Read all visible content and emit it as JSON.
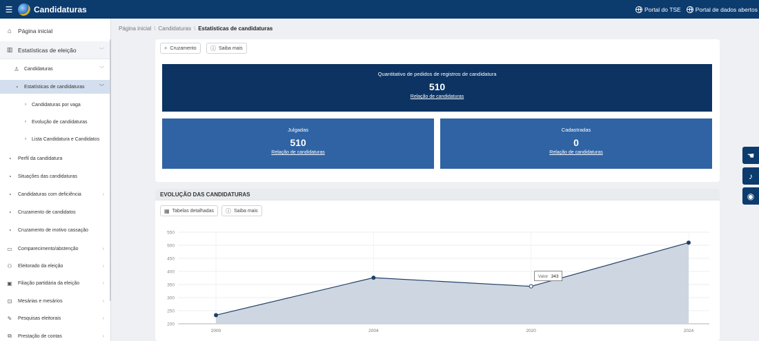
{
  "header": {
    "title": "Candidaturas",
    "links": [
      "Portal do TSE",
      "Portal de dados abertos"
    ]
  },
  "sidebar": {
    "home": "Página inicial",
    "section": "Estatísticas de eleição",
    "candidaturas": "Candidaturas",
    "active": "Estatísticas de candidaturas",
    "subitems": [
      "Candidaturas por vaga",
      "Evolução de candidaturas",
      "Lista Candidatura e Candidatos"
    ],
    "items": [
      "Perfil da candidatura",
      "Situações das candidaturas",
      "Candidaturas com deficiência",
      "Cruzamento de candidatos",
      "Cruzamento de motivo cassação"
    ],
    "main": [
      "Comparecimento/abstenção",
      "Eleitorado da eleição",
      "Filiação partidária da eleição",
      "Mesárias e mesários",
      "Pesquisas eleitorais",
      "Prestação de contas"
    ]
  },
  "breadcrumb": {
    "home": "Página inicial",
    "parent": "Candidaturas",
    "current": "Estatísticas de candidaturas"
  },
  "summary": {
    "cruzamento": "Cruzamento",
    "saiba_mais": "Saiba mais",
    "total_label": "Quantitativo de pedidos de registros de candidatura",
    "total_value": "510",
    "link": "Relação de candidaturas",
    "julgadas_label": "Julgadas",
    "julgadas_value": "510",
    "cadastradas_label": "Cadastradas",
    "cadastradas_value": "0"
  },
  "evolution": {
    "title": "EVOLUÇÃO DAS CANDIDATURAS",
    "tabelas": "Tabelas detalhadas",
    "saiba_mais": "Saiba mais",
    "tooltip_label": "Valor",
    "tooltip_value": "343"
  },
  "chart_data": {
    "type": "area",
    "x": [
      "2000",
      "2004",
      "2020",
      "2024"
    ],
    "values": [
      233,
      376,
      343,
      510
    ],
    "yticks": [
      200,
      250,
      300,
      350,
      400,
      450,
      500,
      550
    ],
    "ylim": [
      200,
      550
    ],
    "grid": true,
    "line_color": "#1e3f66",
    "fill_color": "#c9d2de"
  }
}
